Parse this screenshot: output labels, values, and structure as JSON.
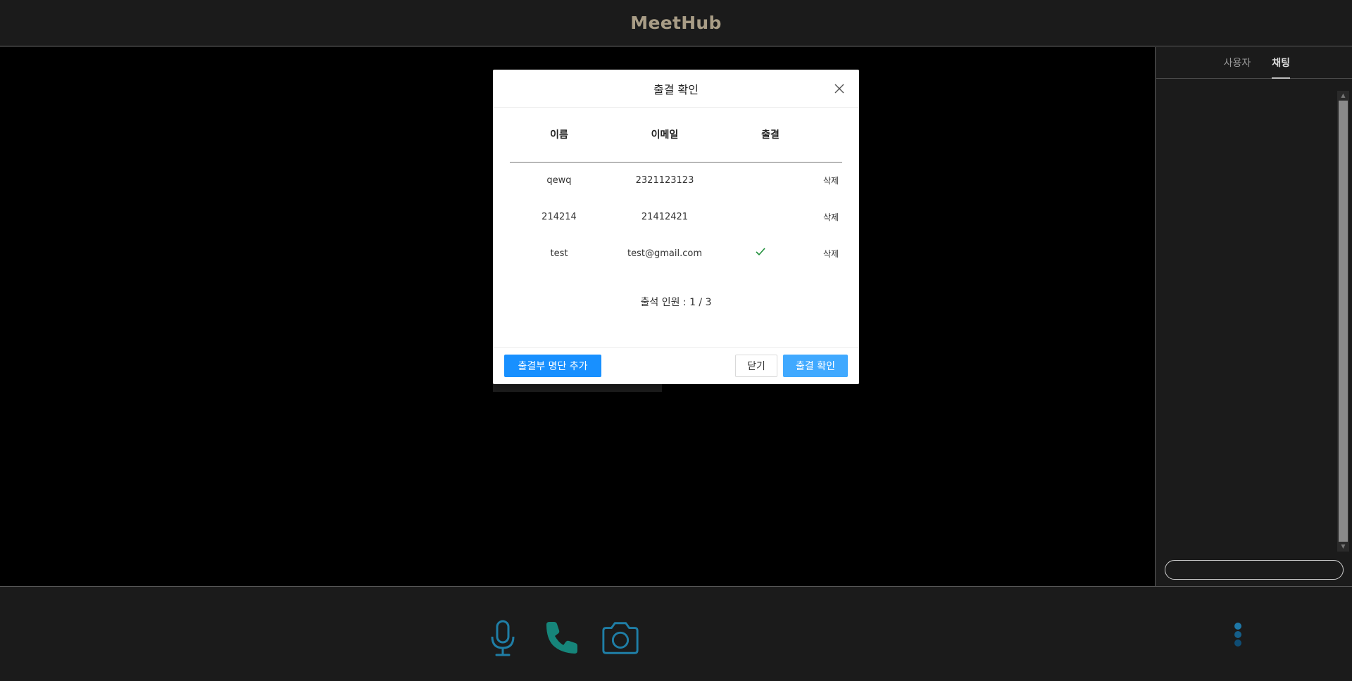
{
  "app": {
    "title": "MeetHub"
  },
  "sidebar": {
    "tabs": [
      {
        "label": "사용자",
        "active": false
      },
      {
        "label": "채팅",
        "active": true
      }
    ],
    "chat_input": {
      "placeholder": ""
    }
  },
  "modal": {
    "title": "출결 확인",
    "columns": {
      "name": "이름",
      "email": "이메일",
      "attendance": "출결"
    },
    "rows": [
      {
        "name": "qewq",
        "email": "2321123123",
        "attended": false,
        "delete": "삭제"
      },
      {
        "name": "214214",
        "email": "21412421",
        "attended": false,
        "delete": "삭제"
      },
      {
        "name": "test",
        "email": "test@gmail.com",
        "attended": true,
        "delete": "삭제"
      }
    ],
    "count_text": "출석 인원 : 1 / 3",
    "buttons": {
      "add": "출결부 명단 추가",
      "close": "닫기",
      "confirm": "출결 확인"
    }
  },
  "controls": {
    "icons": [
      "microphone-icon",
      "phone-icon",
      "camera-icon",
      "more-vertical-icon"
    ],
    "colors": {
      "mic": "#1f7ea6",
      "phone": "#16857a",
      "camera": "#1f7ea6",
      "more": "#1e78a8"
    }
  },
  "colors": {
    "brand": "#a99d86",
    "primary": "#1890ff",
    "check": "#1f8f3a"
  }
}
